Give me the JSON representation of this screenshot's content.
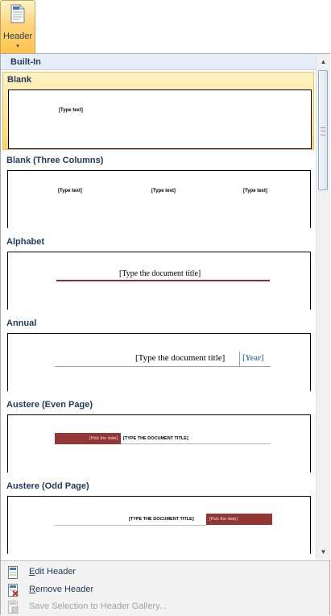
{
  "ribbon": {
    "header_label": "Header",
    "dropdown_arrow": "▾"
  },
  "gallery": {
    "section_title": "Built-In",
    "items": [
      {
        "title": "Blank",
        "texts": [
          "[Type text]"
        ]
      },
      {
        "title": "Blank (Three Columns)",
        "texts": [
          "[Type text]",
          "[Type text]",
          "[Type text]"
        ]
      },
      {
        "title": "Alphabet",
        "doc_title": "[Type the document title]"
      },
      {
        "title": "Annual",
        "doc_title": "[Type the document title]",
        "year": "[Year]"
      },
      {
        "title": "Austere (Even Page)",
        "date": "[Pick the date]",
        "doc_title": "[TYPE THE DOCUMENT TITLE]"
      },
      {
        "title": "Austere (Odd Page)",
        "doc_title": "[TYPE THE DOCUMENT TITLE]",
        "date": "[Pick the date]"
      }
    ]
  },
  "scroll": {
    "up": "▲",
    "down": "▼"
  },
  "commands": {
    "edit": {
      "access_key": "E",
      "rest": "dit Header"
    },
    "remove": {
      "access_key": "R",
      "rest": "emove Header"
    },
    "save": {
      "label": "Save Selection to Header Gallery..."
    }
  },
  "colors": {
    "accent_red": "#943634",
    "heading_blue": "#1e395b",
    "year_blue": "#4f81bd"
  }
}
